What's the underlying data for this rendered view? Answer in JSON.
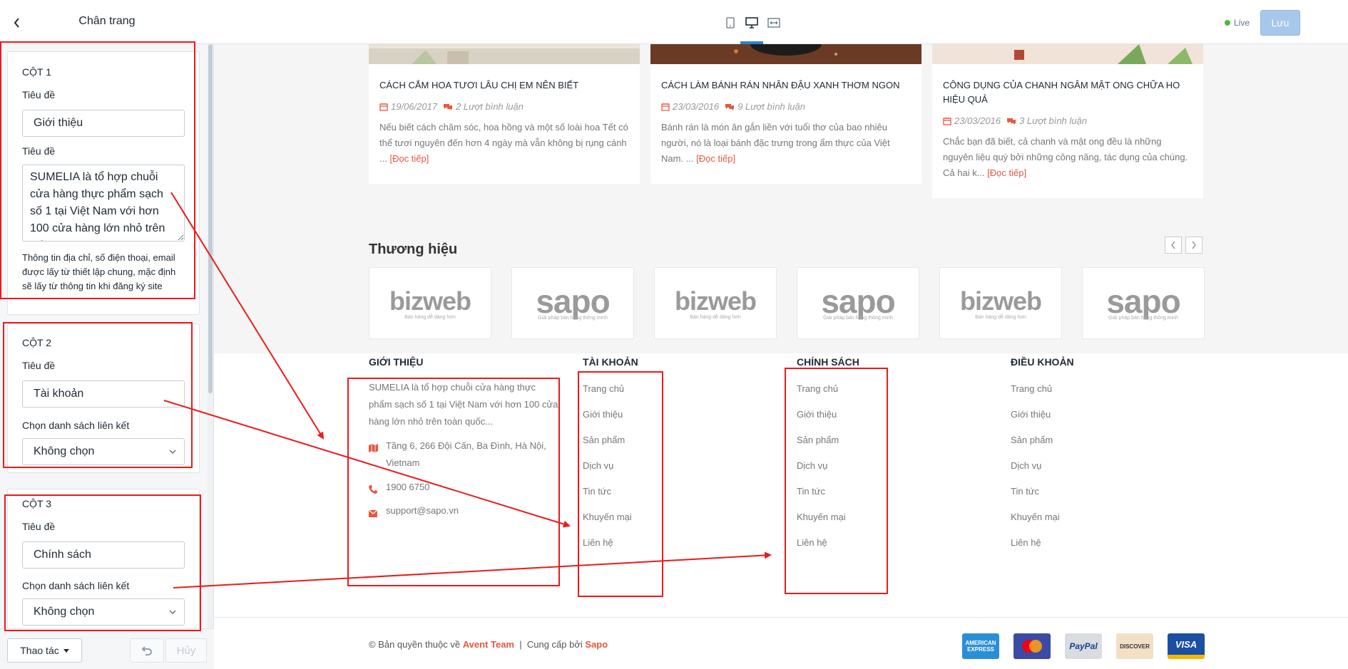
{
  "sidebar": {
    "title": "Chân trang",
    "columns": [
      {
        "heading": "CỘT 1",
        "title_label": "Tiêu đề",
        "title_value": "Giới thiệu",
        "content_label": "Tiêu đề",
        "content_value": "SUMELIA là tổ hợp chuỗi cửa hàng thực phẩm sạch số 1 tại Việt Nam với hơn 100 cửa hàng lớn nhỏ trên toàn",
        "help_text": "Thông tin địa chỉ, số điện thoại, email được lấy từ thiết lập chung, mặc định sẽ lấy từ thông tin khi đăng ký site"
      },
      {
        "heading": "CỘT 2",
        "title_label": "Tiêu đề",
        "title_value": "Tài khoản",
        "link_label": "Chọn danh sách liên kết",
        "link_value": "Không chọn"
      },
      {
        "heading": "CỘT 3",
        "title_label": "Tiêu đề",
        "title_value": "Chính sách",
        "link_label": "Chọn danh sách liên kết",
        "link_value": "Không chọn"
      }
    ],
    "footer": {
      "actions_label": "Thao tác",
      "cancel_label": "Hủy"
    }
  },
  "topbar": {
    "live_label": "Live",
    "save_label": "Lưu"
  },
  "blog": [
    {
      "title": "CÁCH CẮM HOA TƯƠI LÂU CHỊ EM NÊN BIẾT",
      "date": "19/06/2017",
      "comments": "2 Lượt bình luận",
      "excerpt": "Nếu biết cách chăm sóc, hoa hồng và một số loài hoa Tết có thể tươi nguyên đến hơn 4 ngày mà vẫn không bị rụng cánh ...",
      "read_more": "[Đọc tiếp]"
    },
    {
      "title": "CÁCH LÀM BÁNH RÁN NHÂN ĐẬU XANH THƠM NGON",
      "date": "23/03/2016",
      "comments": "9 Lượt bình luận",
      "excerpt": "Bánh rán là món ăn gắn liền với tuổi thơ của bao nhiêu người, nó là loại bánh đặc trưng trong ẩm thực của Việt Nam. ...",
      "read_more": "[Đọc tiếp]"
    },
    {
      "title": "CÔNG DỤNG CỦA CHANH NGÂM MẬT ONG CHỮA HO HIỆU QUẢ",
      "date": "23/03/2016",
      "comments": "3 Lượt bình luận",
      "excerpt": "Chắc bạn đã biết, cả chanh và mật ong đều là những nguyên liệu quý bởi những công năng, tác dụng của chúng. Cả hai k...",
      "read_more": "[Đọc tiếp]"
    }
  ],
  "brands": {
    "title": "Thương hiệu",
    "logos": [
      {
        "name": "bizweb",
        "sub": "Bán hàng dễ dàng hơn"
      },
      {
        "name": "sapo",
        "sub": "Giải pháp bán hàng thông minh"
      },
      {
        "name": "bizweb",
        "sub": "Bán hàng dễ dàng hơn"
      },
      {
        "name": "sapo",
        "sub": "Giải pháp bán hàng thông minh"
      },
      {
        "name": "bizweb",
        "sub": "Bán hàng dễ dàng hơn"
      },
      {
        "name": "sapo",
        "sub": "Giải pháp bán hàng thông minh"
      }
    ]
  },
  "footer": {
    "about": {
      "heading": "GIỚI THIỆU",
      "text": "SUMELIA là tổ hợp chuỗi cửa hàng thực phẩm sạch số 1 tại Việt Nam với hơn 100 cửa hàng lớn nhỏ trên toàn quốc...",
      "address": "Tầng 6, 266 Đội Cấn, Ba Đình, Hà Nội, Vietnam",
      "phone": "1900 6750",
      "email": "support@sapo.vn"
    },
    "columns": [
      {
        "heading": "TÀI KHOẢN",
        "links": [
          "Trang chủ",
          "Giới thiệu",
          "Sản phẩm",
          "Dịch vụ",
          "Tin tức",
          "Khuyến mại",
          "Liên hệ"
        ]
      },
      {
        "heading": "CHÍNH SÁCH",
        "links": [
          "Trang chủ",
          "Giới thiệu",
          "Sản phẩm",
          "Dịch vụ",
          "Tin tức",
          "Khuyến mại",
          "Liên hệ"
        ]
      },
      {
        "heading": "ĐIỀU KHOẢN",
        "links": [
          "Trang chủ",
          "Giới thiệu",
          "Sản phẩm",
          "Dịch vụ",
          "Tin tức",
          "Khuyến mại",
          "Liên hệ"
        ]
      }
    ],
    "copyright_prefix": "© Bản quyền thuộc về",
    "copyright_owner": "Avent Team",
    "copyright_sep": "|",
    "copyright_provider_prefix": "Cung cấp bởi",
    "copyright_provider": "Sapo",
    "payments": [
      {
        "name": "AMERICAN EXPRESS",
        "bg": "#2b8fd6",
        "fg": "#ffffff"
      },
      {
        "name": "mastercard",
        "bg": "#3a4aa5",
        "fg": "#ffffff"
      },
      {
        "name": "PayPal",
        "bg": "#d9dde2",
        "fg": "#1a3e8c"
      },
      {
        "name": "DISCOVER",
        "bg": "#f1e0c6",
        "fg": "#333333"
      },
      {
        "name": "VISA",
        "bg": "#1a4fa3",
        "fg": "#ffffff"
      }
    ]
  },
  "colors": {
    "accent": "#e8573f",
    "annotation": "#ea1b1b",
    "primary_button": "#a7c8ea",
    "live": "#50b83c"
  },
  "icons": [
    "chevron-left-icon",
    "mobile-icon",
    "desktop-icon",
    "fullwidth-icon",
    "calendar-icon",
    "comment-icon",
    "map-icon",
    "phone-icon",
    "email-icon",
    "undo-icon",
    "caret-down-icon"
  ]
}
